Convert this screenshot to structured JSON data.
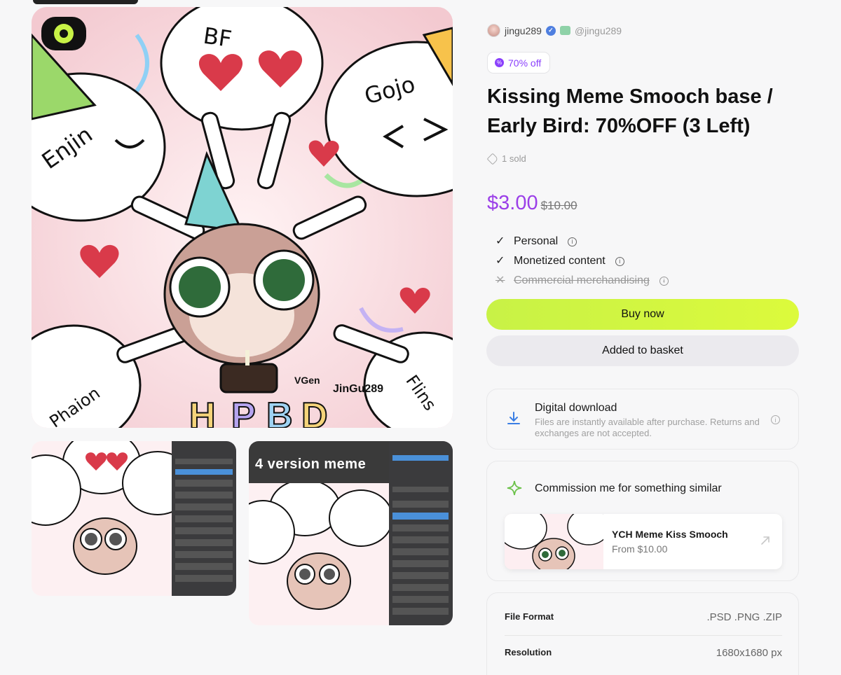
{
  "creator": {
    "name": "jingu289",
    "handle": "@jingu289"
  },
  "product": {
    "discount_label": "70% off",
    "title": "Kissing Meme Smooch base / Early Bird: 70%OFF (3 Left)",
    "sold": "1 sold",
    "price": "$3.00",
    "original_price": "$10.00",
    "accent_color": "#9b3fe8",
    "buy_color": "#d4f840"
  },
  "gallery": {
    "hero_labels": [
      "BF",
      "Gojo",
      "Enjin",
      "Flins",
      "Phaion",
      "HPBD"
    ],
    "watermark_brand": "VGen",
    "watermark_user": "JinGu289",
    "thumb2_banner": "4 version meme"
  },
  "licenses": [
    {
      "label": "Personal",
      "included": true
    },
    {
      "label": "Monetized content",
      "included": true
    },
    {
      "label": "Commercial merchandising",
      "included": false
    }
  ],
  "actions": {
    "buy_label": "Buy now",
    "basket_label": "Added to basket"
  },
  "download": {
    "title": "Digital download",
    "description": "Files are instantly available after purchase. Returns and exchanges are not accepted."
  },
  "commission": {
    "title": "Commission me for something similar",
    "ych_name": "YCH Meme Kiss Smooch",
    "ych_price": "From $10.00"
  },
  "specs": [
    {
      "key": "File Format",
      "value": ".PSD .PNG .ZIP"
    },
    {
      "key": "Resolution",
      "value": "1680x1680 px"
    }
  ]
}
